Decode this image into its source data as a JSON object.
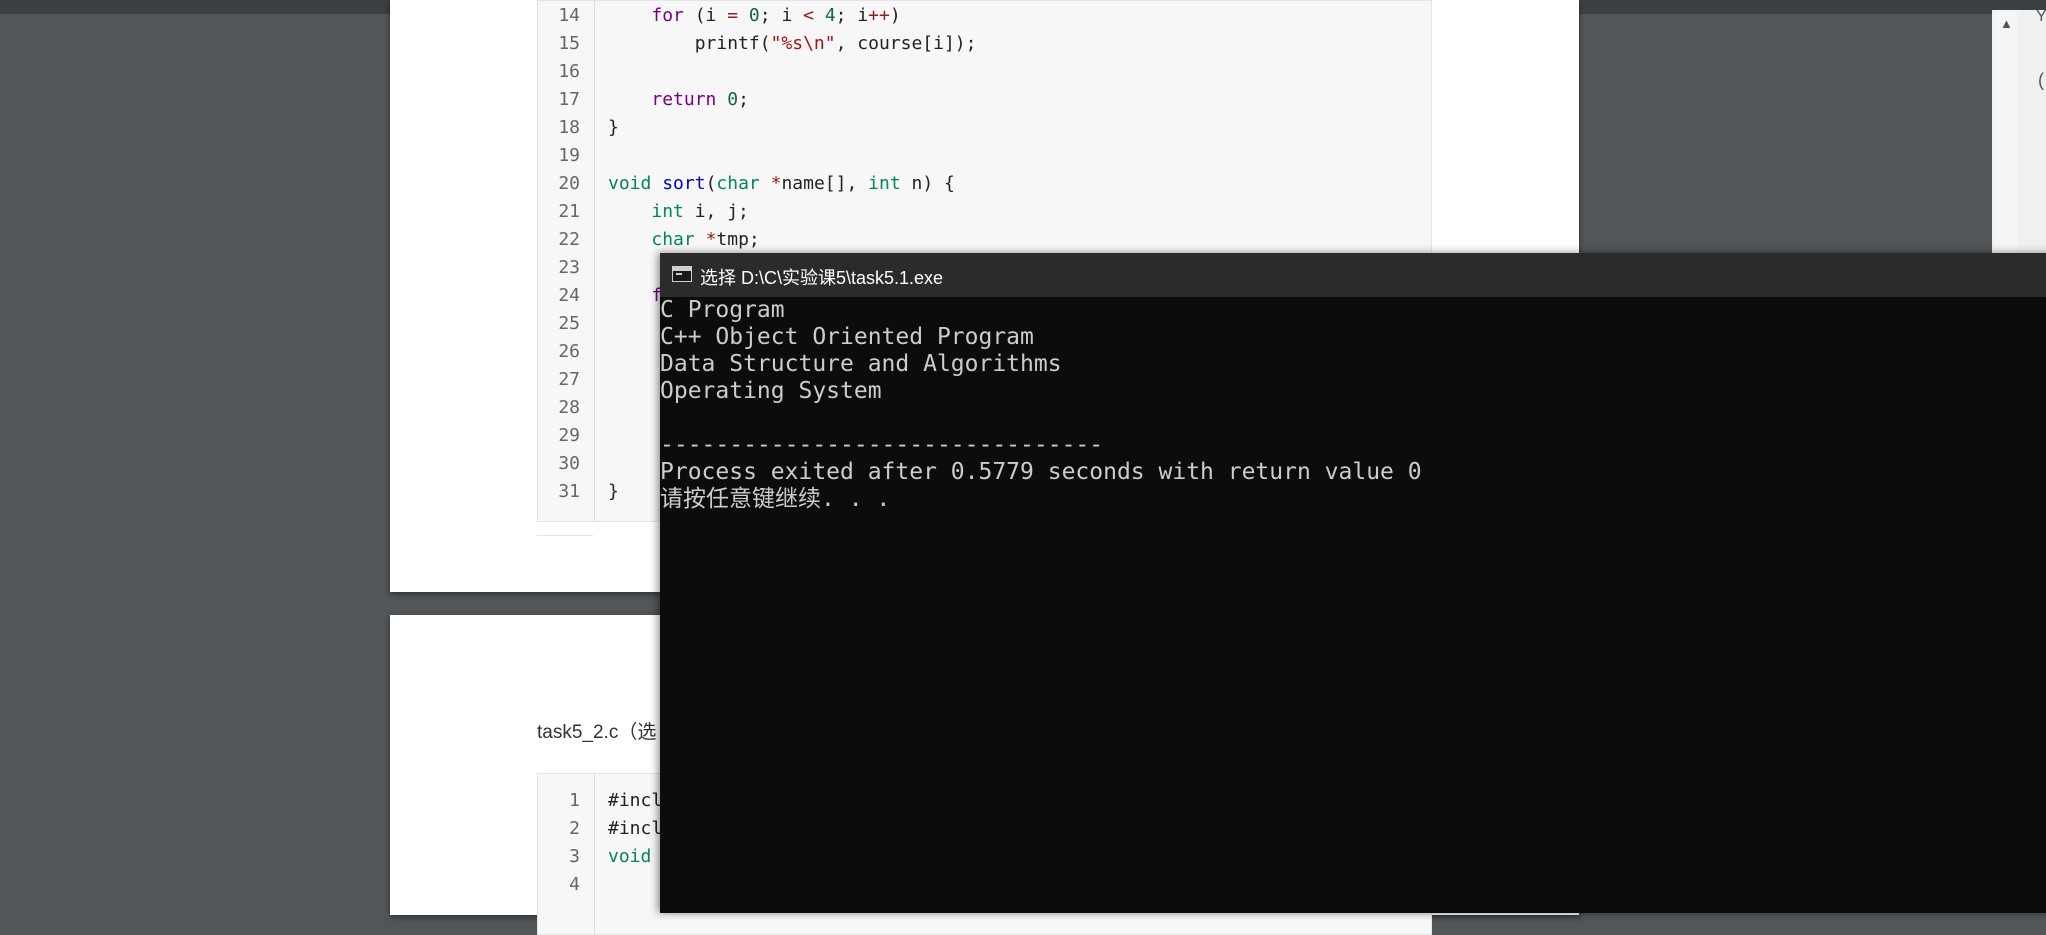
{
  "doc": {
    "code_block_1": {
      "lines": [
        {
          "n": "14",
          "html": "    <span class=\"kw\">for</span> (i <span class=\"op\">=</span> <span class=\"nm\">0</span>; i <span class=\"op\">&lt;</span> <span class=\"nm\">4</span>; i<span class=\"op\">++</span>)"
        },
        {
          "n": "15",
          "html": "        printf(<span class=\"st\">\"%s\\n\"</span>, course[i]);"
        },
        {
          "n": "16",
          "html": ""
        },
        {
          "n": "17",
          "html": "    <span class=\"kw\">return</span> <span class=\"nm\">0</span>;"
        },
        {
          "n": "18",
          "html": "}"
        },
        {
          "n": "19",
          "html": ""
        },
        {
          "n": "20",
          "html": "<span class=\"ty\">void</span> <span class=\"fn\">sort</span>(<span class=\"ty\">char</span> <span class=\"op\">*</span>name[], <span class=\"ty\">int</span> n) {"
        },
        {
          "n": "21",
          "html": "    <span class=\"ty\">int</span> i, j;"
        },
        {
          "n": "22",
          "html": "    <span class=\"ty\">char</span> <span class=\"op\">*</span>tmp;"
        },
        {
          "n": "23",
          "html": ""
        },
        {
          "n": "24",
          "html": "    <span class=\"kw\">f</span>"
        },
        {
          "n": "25",
          "html": ""
        },
        {
          "n": "26",
          "html": ""
        },
        {
          "n": "27",
          "html": ""
        },
        {
          "n": "28",
          "html": ""
        },
        {
          "n": "29",
          "html": ""
        },
        {
          "n": "30",
          "html": ""
        },
        {
          "n": "31",
          "html": "}"
        }
      ]
    },
    "section_label": "task5_2.c（选",
    "code_block_2": {
      "lines": [
        {
          "n": "1",
          "html": "#incl"
        },
        {
          "n": "2",
          "html": "#incl"
        },
        {
          "n": "3",
          "html": "<span class=\"ty\">void</span>"
        },
        {
          "n": "4",
          "html": ""
        }
      ]
    }
  },
  "console": {
    "title": "选择 D:\\C\\实验课5\\task5.1.exe",
    "lines": [
      "C Program",
      "C++ Object Oriented Program",
      "Data Structure and Algorithms",
      "Operating System",
      "",
      "--------------------------------",
      "Process exited after 0.5779 seconds with return value 0",
      "请按任意键继续. . ."
    ]
  },
  "scrollbar": {
    "up_arrow": "▲"
  },
  "right_glyphs": {
    "a": "Y",
    "b": "("
  },
  "colors": {
    "viewer_bg": "#525659",
    "console_bg": "#0c0c0c",
    "console_fg": "#cccccc",
    "titlebar_bg": "#2b2b2b",
    "code_bg": "#f7f7f7"
  }
}
